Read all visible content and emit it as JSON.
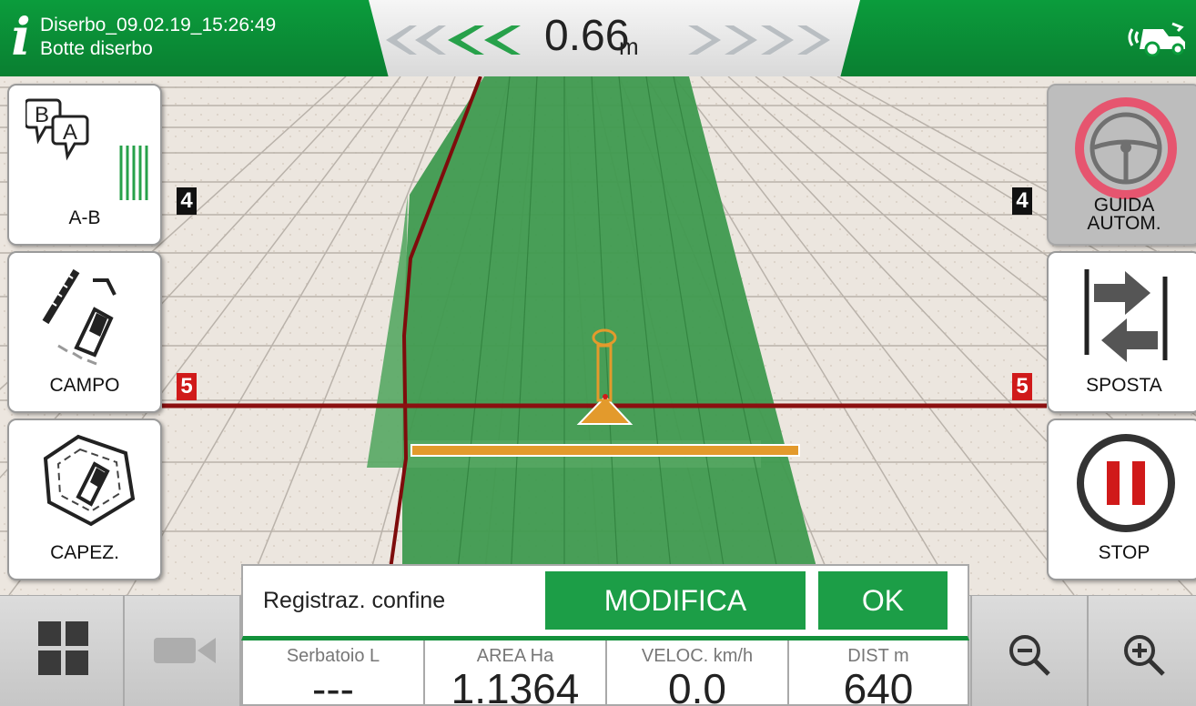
{
  "header": {
    "job_name": "Diserbo_09.02.19_15:26:49",
    "implement": "Botte diserbo",
    "offset_value": "0.66",
    "offset_unit": "m"
  },
  "left_buttons": [
    {
      "label": "A-B"
    },
    {
      "label": "CAMPO"
    },
    {
      "label": "CAPEZ."
    }
  ],
  "right_buttons": [
    {
      "label_line1": "GUIDA",
      "label_line2": "AUTOM."
    },
    {
      "label": "SPOSTA"
    },
    {
      "label": "STOP"
    }
  ],
  "markers": {
    "row4": "4",
    "row5": "5"
  },
  "boundary_panel": {
    "label": "Registraz. confine",
    "modify_label": "MODIFICA",
    "ok_label": "OK"
  },
  "stats": [
    {
      "title": "Serbatoio L",
      "value": "---"
    },
    {
      "title": "AREA Ha",
      "value": "1.1364"
    },
    {
      "title": "VELOC. km/h",
      "value": "0.0"
    },
    {
      "title": "DIST m",
      "value": "640"
    }
  ],
  "icons": {
    "info": "i",
    "logo": "tractor-signal-icon"
  },
  "colors": {
    "brand_green": "#0b9c3c",
    "field_green": "#3f9a4f",
    "boundary_red": "#8b1010",
    "implement_orange": "#e39a2c",
    "stop_red": "#d01a1a"
  }
}
